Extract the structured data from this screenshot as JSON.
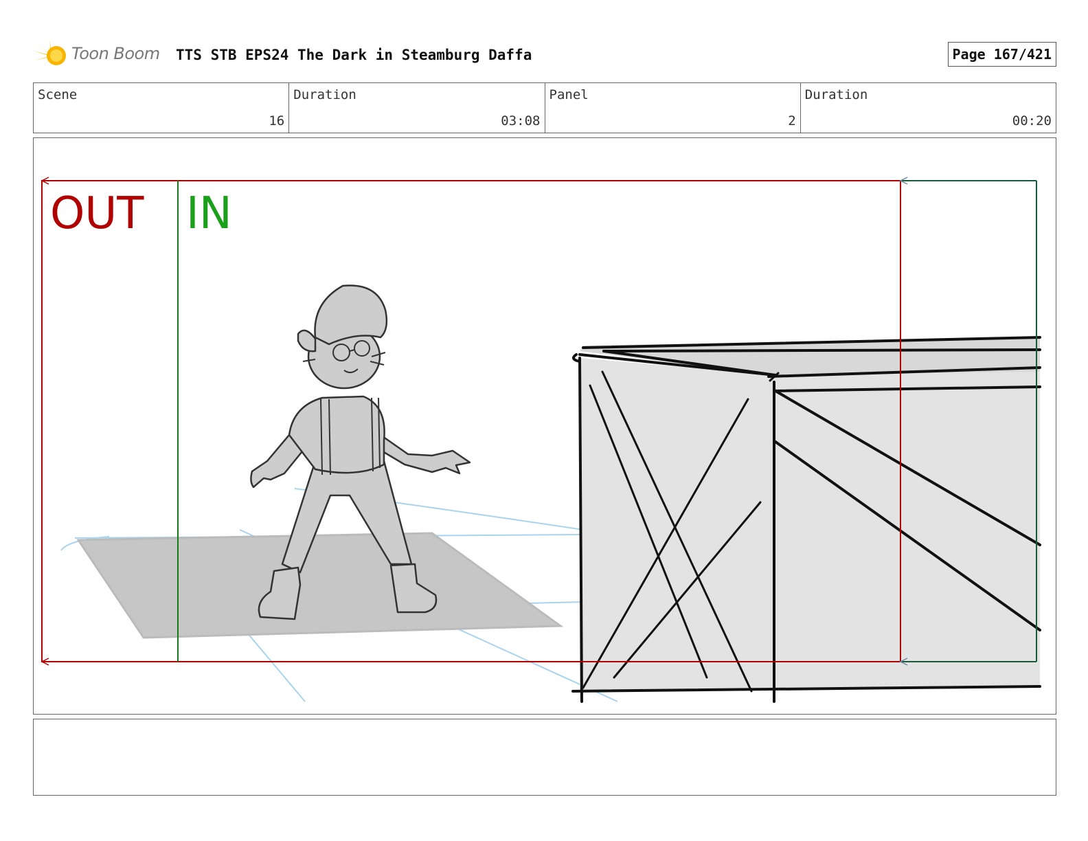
{
  "header": {
    "logo_text": "Toon Boom",
    "project_title": "TTS STB EPS24 The Dark in Steamburg Daffa",
    "page_label": "Page 167/421"
  },
  "info": {
    "scene_label": "Scene",
    "scene_value": "16",
    "scene_duration_label": "Duration",
    "scene_duration_value": "03:08",
    "panel_label": "Panel",
    "panel_value": "2",
    "panel_duration_label": "Duration",
    "panel_duration_value": "00:20"
  },
  "panel": {
    "out_label": "OUT",
    "in_label": "IN",
    "out_color": "#b00000",
    "in_color": "#1aa01a"
  },
  "notes": {
    "text": ""
  }
}
